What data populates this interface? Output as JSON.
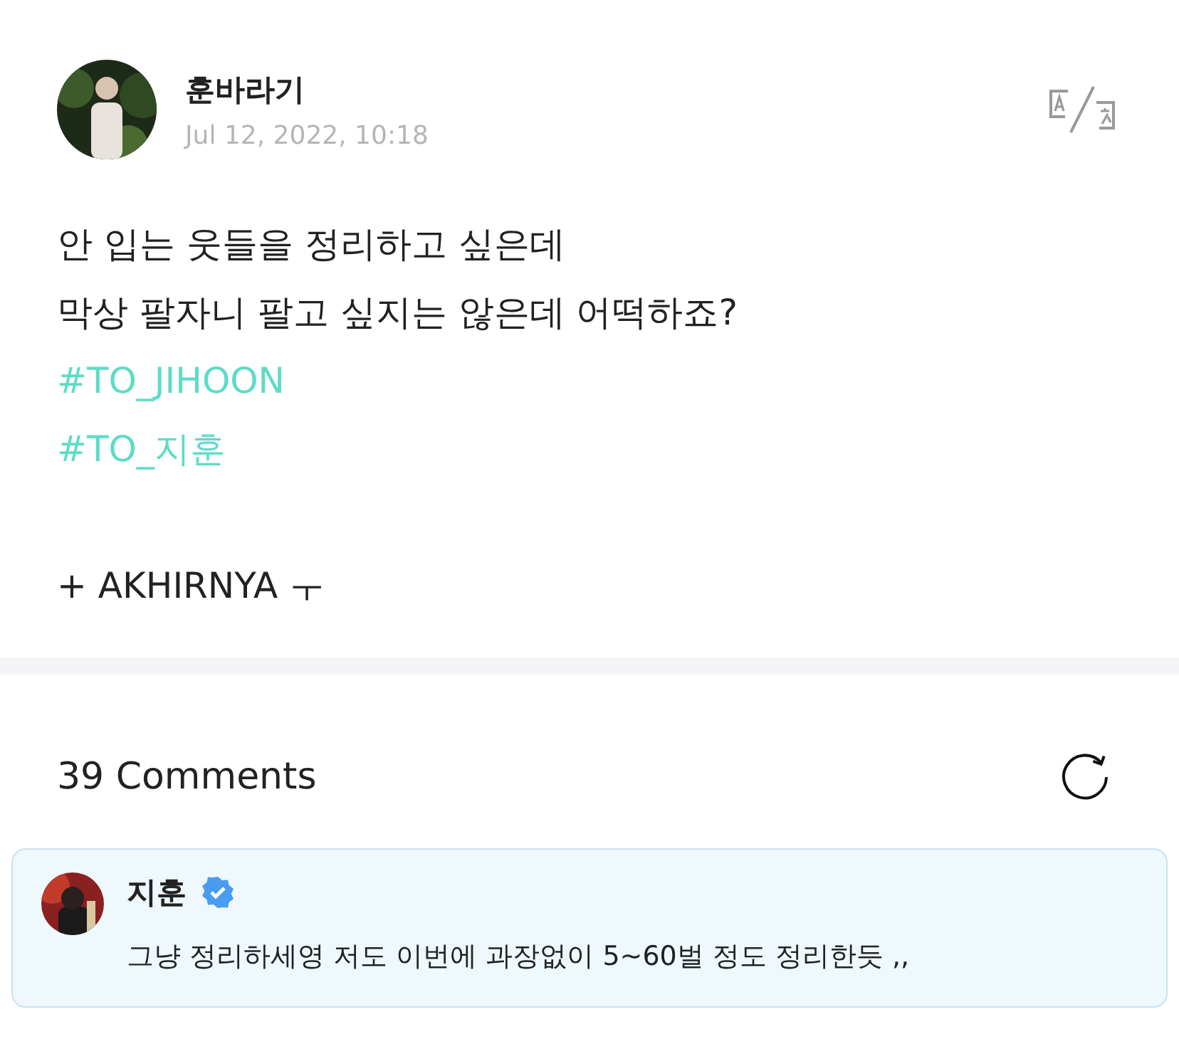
{
  "post": {
    "author": "훈바라기",
    "date": "Jul 12, 2022, 10:18",
    "lines": [
      {
        "kind": "text",
        "text": "안 입는 웃들을 정리하고 싶은데"
      },
      {
        "kind": "text",
        "text": "막상 팔자니 팔고 싶지는 않은데 어떡하죠?"
      },
      {
        "kind": "hashtag",
        "text": "#TO_JIHOON"
      },
      {
        "kind": "hashtag",
        "text": "#TO_지훈"
      },
      {
        "kind": "blank"
      },
      {
        "kind": "text",
        "text": "+ AKHIRNYA ㅜ"
      }
    ]
  },
  "comments_header": {
    "title": "39 Comments"
  },
  "comment": {
    "author": "지훈",
    "verified": true,
    "text": "그냥 정리하세영 저도 이번에 과장없이 5~60벌 정도 정리한듯 ,,"
  }
}
